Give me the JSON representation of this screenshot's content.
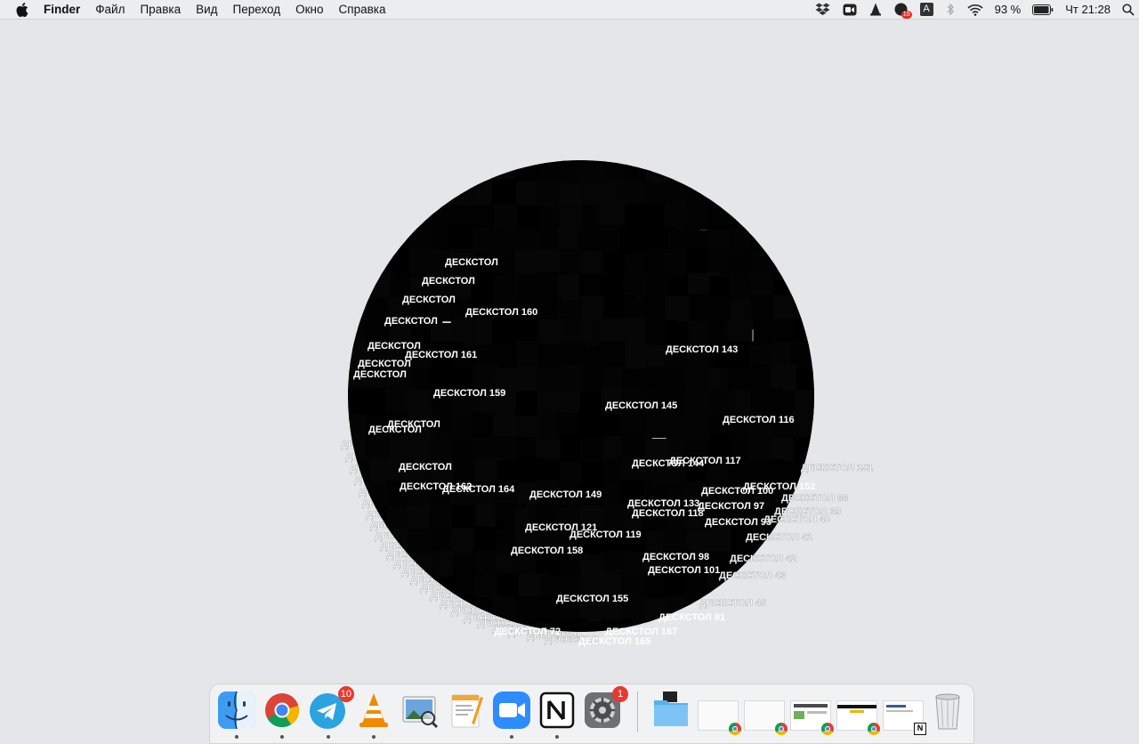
{
  "menubar": {
    "apple_icon": "apple-logo-icon",
    "app_name": "Finder",
    "menus": [
      "Файл",
      "Правка",
      "Вид",
      "Переход",
      "Окно",
      "Справка"
    ],
    "status": {
      "notification_badge": "10",
      "keyboard_layout": "A",
      "battery": "93 %",
      "clock": "Чт 21:28"
    }
  },
  "desktop": {
    "label_prefix": "ДЕСКСТОЛ",
    "labels_visible": [
      "ДЕСКСТОЛ 160",
      "ДЕСКСТОЛ 161",
      "ДЕСКСТОЛ 159",
      "ДЕСКСТОЛ 143",
      "ДЕСКСТОЛ 145",
      "ДЕСКСТОЛ 116",
      "ДЕСКСТОЛ 144",
      "ДЕСКСТОЛ 117",
      "ДЕСКСТОЛ 162",
      "ДЕСКСТОЛ 164",
      "ДЕСКСТОЛ 149",
      "ДЕСКСТОЛ 133",
      "ДЕСКСТОЛ 118",
      "ДЕСКСТОЛ 100",
      "ДЕСКСТОЛ 152",
      "ДЕСКСТОЛ 97",
      "ДЕСКСТОЛ 93",
      "ДЕСКСТОЛ 121",
      "ДЕСКСТОЛ 119",
      "ДЕСКСТОЛ 158",
      "ДЕСКСТОЛ 98",
      "ДЕСКСТОЛ 101",
      "ДЕСКСТОЛ 155",
      "ДЕСКСТОЛ 81",
      "ДЕСКСТОЛ 72",
      "ДЕСКСТОЛ 167",
      "ДЕСКСТОЛ 165",
      "ДЕСКСТОЛ 151",
      "ДЕСКСТОЛ 88",
      "ДЕСКСТОЛ 39",
      "ДЕСКСТОЛ 40",
      "ДЕСКСТОЛ 41",
      "ДЕСКСТОЛ 42",
      "ДЕСКСТОЛ 43",
      "ДЕСКСТОЛ 46"
    ]
  },
  "dock": {
    "apps": [
      {
        "name": "Finder",
        "icon": "finder-icon",
        "running": true
      },
      {
        "name": "Google Chrome",
        "icon": "chrome-icon",
        "running": true
      },
      {
        "name": "Telegram",
        "icon": "telegram-icon",
        "running": true,
        "badge": "10"
      },
      {
        "name": "VLC",
        "icon": "vlc-icon",
        "running": true
      },
      {
        "name": "Preview",
        "icon": "preview-icon",
        "running": false
      },
      {
        "name": "Pages",
        "icon": "pages-icon",
        "running": false
      },
      {
        "name": "Zoom",
        "icon": "zoom-icon",
        "running": true
      },
      {
        "name": "Notion",
        "icon": "notion-icon",
        "running": true
      },
      {
        "name": "System Preferences",
        "icon": "gear-icon",
        "running": false,
        "badge": "1"
      }
    ],
    "right_items": [
      {
        "name": "Folder",
        "icon": "folder-icon"
      },
      {
        "name": "Chrome window",
        "icon": "chrome-window-thumbnail"
      },
      {
        "name": "Chrome window",
        "icon": "chrome-window-thumbnail"
      },
      {
        "name": "Chrome window",
        "icon": "chrome-window-thumbnail"
      },
      {
        "name": "Chrome window",
        "icon": "chrome-window-thumbnail"
      },
      {
        "name": "Notion window",
        "icon": "notion-window-thumbnail"
      },
      {
        "name": "Trash",
        "icon": "trash-icon"
      }
    ]
  }
}
